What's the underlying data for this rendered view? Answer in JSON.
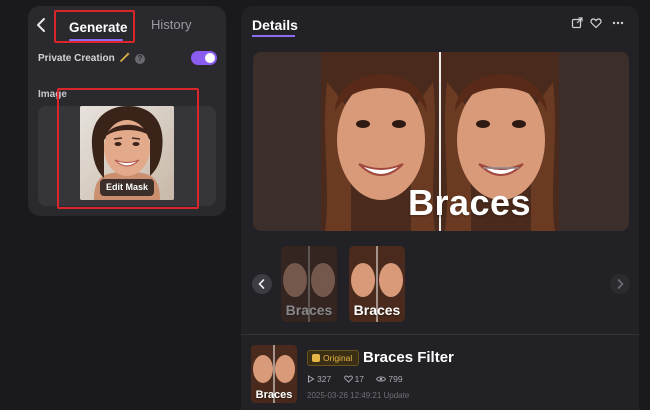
{
  "header": {
    "tabs": [
      "Generate",
      "History"
    ],
    "active_tab": "Generate"
  },
  "settings": {
    "private_creation_label": "Private Creation",
    "private_creation_enabled": true,
    "image_label": "Image",
    "edit_mask_label": "Edit Mask"
  },
  "details": {
    "title": "Details",
    "preview_title": "Braces",
    "thumbnails": [
      {
        "label": "Braces",
        "selected": false
      },
      {
        "label": "Braces",
        "selected": true
      }
    ],
    "badge": "Original",
    "filter_name": "Braces Filter",
    "stats": {
      "runs": "327",
      "likes": "17",
      "views": "799"
    },
    "updated": "2025-03-26 12:49:21 Update"
  },
  "icons": {
    "back": "chevron-left-icon",
    "wand": "magic-wand-icon",
    "help": "help-circle-icon",
    "share": "share-icon",
    "favorite": "heart-icon",
    "more": "more-horizontal-icon",
    "prev": "chevron-left-icon",
    "next": "chevron-right-icon",
    "play": "play-icon",
    "like": "heart-icon",
    "views": "eye-icon"
  },
  "colors": {
    "accent": "#8a5cf0",
    "highlight": "#d8262c",
    "badge": "#e5b54a",
    "background": "#1a1a1c",
    "panel": "#2a2a2e"
  }
}
